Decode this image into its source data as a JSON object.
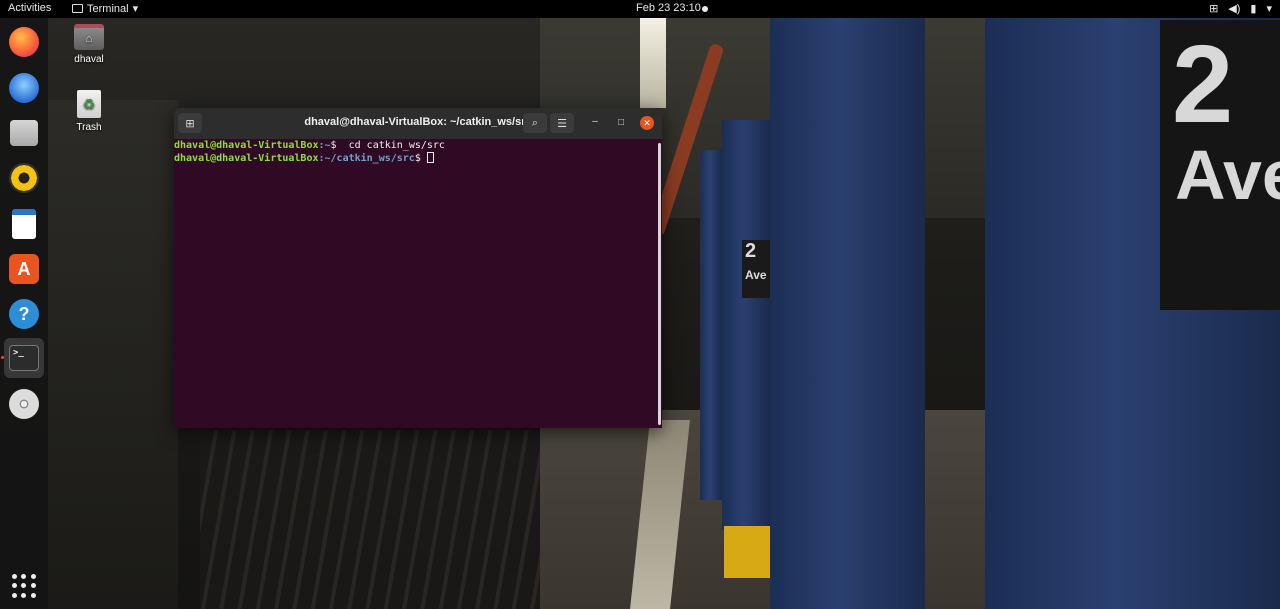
{
  "topbar": {
    "activities": "Activities",
    "app_name": "Terminal",
    "app_menu_arrow": "▾",
    "clock": "Feb 23  23:10",
    "tray_network": "⊞",
    "tray_volume": "◀)",
    "tray_power": "▮",
    "tray_menu": "▾"
  },
  "dock": {
    "items": [
      {
        "name": "Firefox",
        "icon": "firefox-icon"
      },
      {
        "name": "Thunderbird",
        "icon": "thunderbird-icon"
      },
      {
        "name": "Files",
        "icon": "files-icon"
      },
      {
        "name": "Rhythmbox",
        "icon": "rhythmbox-icon"
      },
      {
        "name": "LibreOffice Writer",
        "icon": "writer-icon"
      },
      {
        "name": "Ubuntu Software",
        "icon": "software-icon"
      },
      {
        "name": "Help",
        "icon": "help-icon"
      },
      {
        "name": "Terminal",
        "icon": "terminal-icon"
      },
      {
        "name": "DVD",
        "icon": "dvd-icon"
      },
      {
        "name": "Show Applications",
        "icon": "app-grid-icon"
      }
    ],
    "software_glyph": "A",
    "help_glyph": "?",
    "terminal_glyph": ">_"
  },
  "desktop": {
    "home_label": "dhaval",
    "home_glyph": "⌂",
    "trash_label": "Trash",
    "trash_glyph": "♻"
  },
  "terminal": {
    "title": "dhaval@dhaval-VirtualBox: ~/catkin_ws/src",
    "new_tab_glyph": "⊞",
    "search_glyph": "⌕",
    "menu_glyph": "☰",
    "minimize_glyph": "–",
    "maximize_glyph": "□",
    "close_glyph": "✕",
    "lines": [
      {
        "user": "dhaval@dhaval-VirtualBox",
        "path": ":~",
        "symbol": "$ ",
        "command": " cd catkin_ws/src"
      },
      {
        "user": "dhaval@dhaval-VirtualBox",
        "path": ":~/catkin_ws/src",
        "symbol": "$ ",
        "command": ""
      }
    ]
  },
  "wallpaper": {
    "sign_number": "2",
    "sign_text": "Ave",
    "small_sign": "2\nAve"
  },
  "colors": {
    "terminal_bg": "#300a24",
    "prompt_user": "#8ae234",
    "prompt_path": "#729fcf",
    "accent": "#e95420"
  }
}
